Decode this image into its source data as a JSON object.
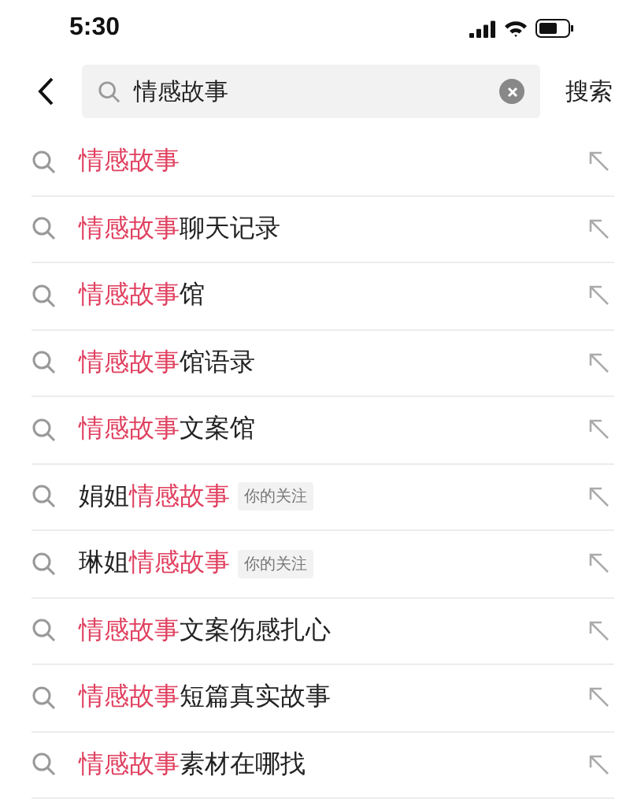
{
  "status_bar": {
    "time": "5:30"
  },
  "search": {
    "value": "情感故事",
    "action": "搜索"
  },
  "suggestions": [
    {
      "segments": [
        {
          "text": "情感故事",
          "highlight": true
        }
      ]
    },
    {
      "segments": [
        {
          "text": "情感故事",
          "highlight": true
        },
        {
          "text": "聊天记录",
          "highlight": false
        }
      ]
    },
    {
      "segments": [
        {
          "text": "情感故事",
          "highlight": true
        },
        {
          "text": "馆",
          "highlight": false
        }
      ]
    },
    {
      "segments": [
        {
          "text": "情感故事",
          "highlight": true
        },
        {
          "text": "馆语录",
          "highlight": false
        }
      ]
    },
    {
      "segments": [
        {
          "text": "情感故事",
          "highlight": true
        },
        {
          "text": "文案馆",
          "highlight": false
        }
      ]
    },
    {
      "segments": [
        {
          "text": "娟姐",
          "highlight": false
        },
        {
          "text": "情感故事",
          "highlight": true
        }
      ],
      "tag": "你的关注"
    },
    {
      "segments": [
        {
          "text": "琳姐",
          "highlight": false
        },
        {
          "text": "情感故事",
          "highlight": true
        }
      ],
      "tag": "你的关注"
    },
    {
      "segments": [
        {
          "text": "情感故事",
          "highlight": true
        },
        {
          "text": "文案伤感扎心",
          "highlight": false
        }
      ]
    },
    {
      "segments": [
        {
          "text": "情感故事",
          "highlight": true
        },
        {
          "text": "短篇真实故事",
          "highlight": false
        }
      ]
    },
    {
      "segments": [
        {
          "text": "情感故事",
          "highlight": true
        },
        {
          "text": "素材在哪找",
          "highlight": false
        }
      ]
    }
  ]
}
